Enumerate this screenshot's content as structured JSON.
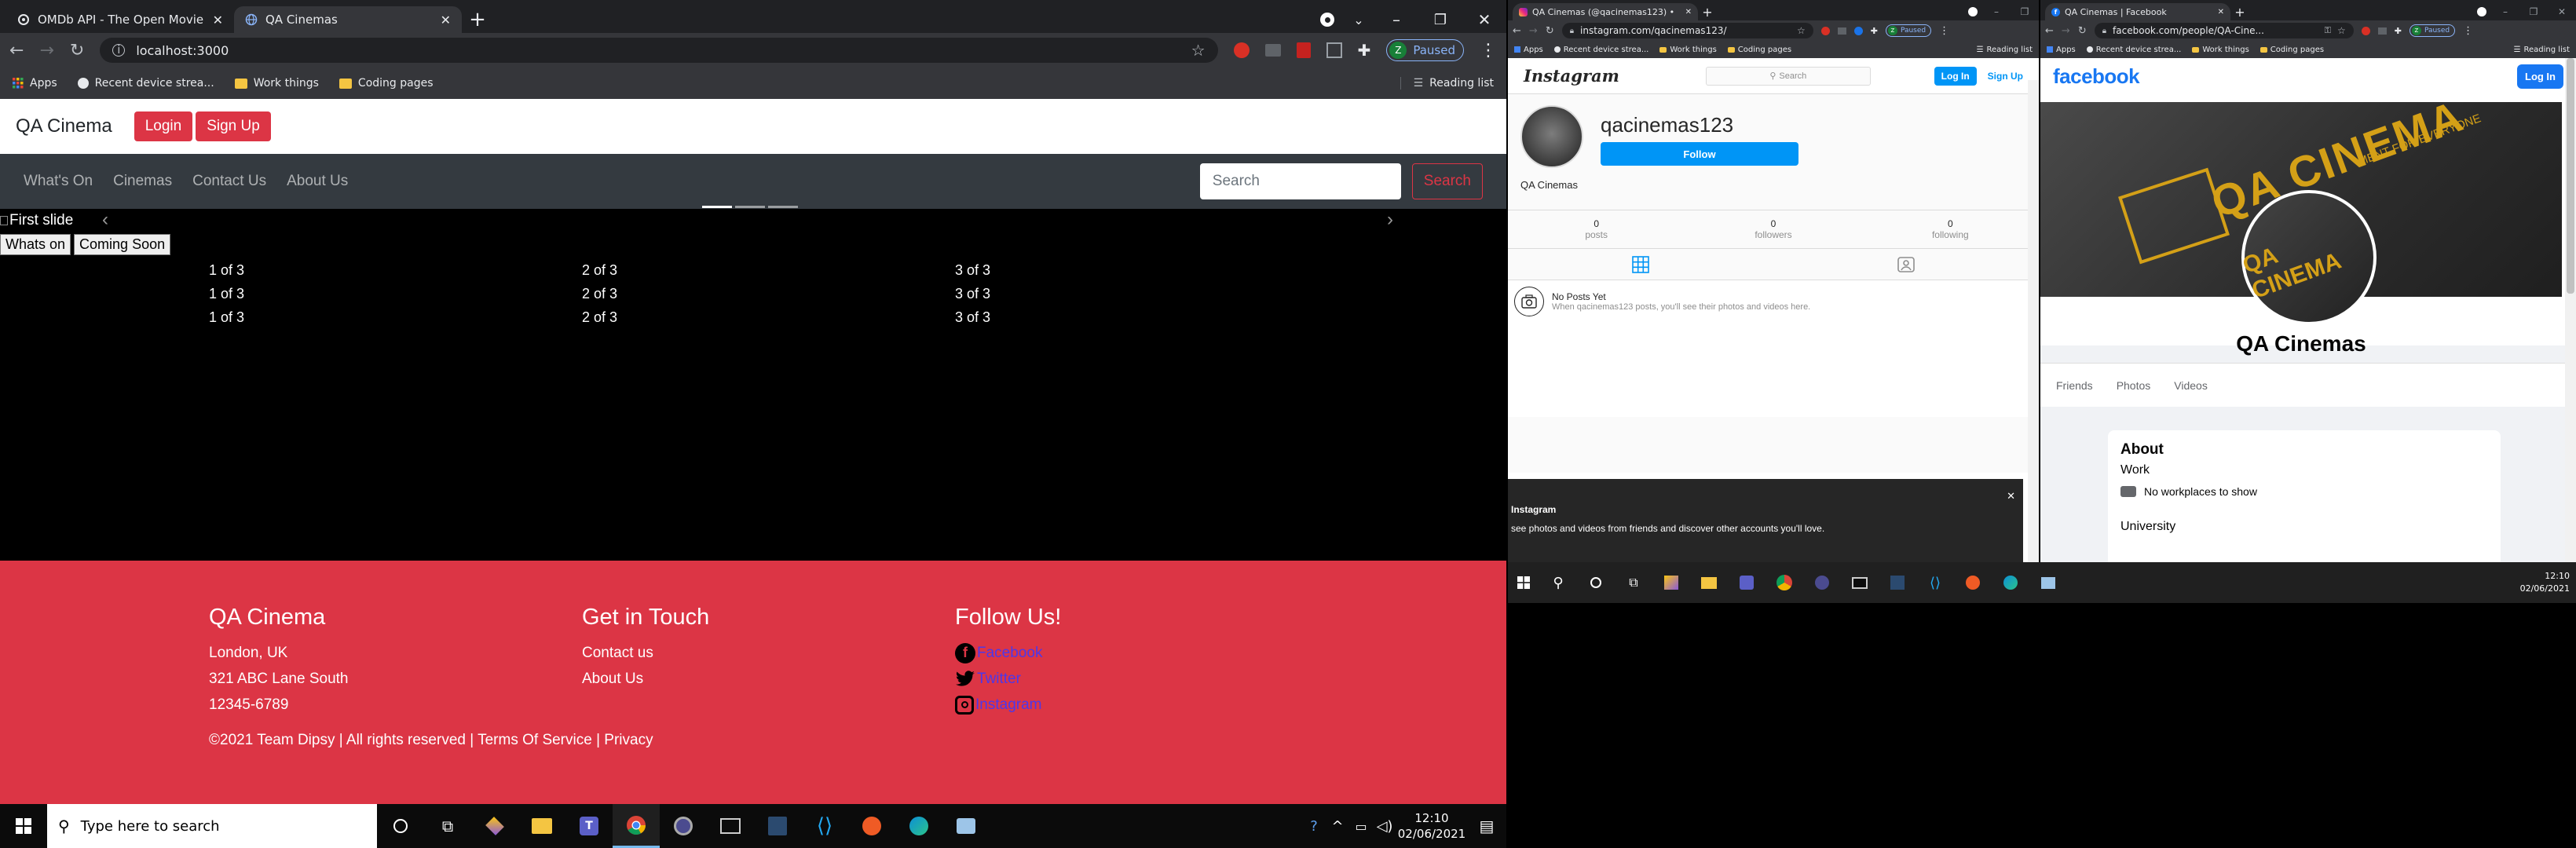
{
  "main_window": {
    "tabs": [
      {
        "title": "OMDb API - The Open Movie Da",
        "favicon": "omdb"
      },
      {
        "title": "QA Cinemas",
        "favicon": "globe"
      }
    ],
    "url": "localhost:3000",
    "paused_label": "Paused",
    "profile_letter": "Z",
    "bookmarks": [
      "Apps",
      "Recent device strea...",
      "Work things",
      "Coding pages"
    ],
    "reading_list": "Reading list"
  },
  "site": {
    "brand": "QA Cinema",
    "login": "Login",
    "signup": "Sign Up",
    "nav": [
      "What's On",
      "Cinemas",
      "Contact Us",
      "About Us"
    ],
    "search_placeholder": "Search",
    "search_button": "Search",
    "carousel_alt": "First slide",
    "slide_buttons": [
      "Whats on",
      "Coming Soon"
    ],
    "grid_rows": [
      [
        "1 of 3",
        "2 of 3",
        "3 of 3"
      ],
      [
        "1 of 3",
        "2 of 3",
        "3 of 3"
      ],
      [
        "1 of 3",
        "2 of 3",
        "3 of 3"
      ]
    ],
    "footer": {
      "col1_title": "QA Cinema",
      "col1_lines": [
        "London, UK",
        "321 ABC Lane South",
        "12345-6789"
      ],
      "col2_title": "Get in Touch",
      "col2_links": [
        "Contact us",
        "About Us"
      ],
      "col3_title": "Follow Us!",
      "col3_links": [
        "Facebook",
        "Twitter",
        "Instagram"
      ],
      "copyright": "©2021 Team Dipsy | All rights reserved | Terms Of Service | Privacy"
    }
  },
  "taskbar_main": {
    "search_placeholder": "Type here to search",
    "time": "12:10",
    "date": "02/06/2021"
  },
  "instagram_window": {
    "tab_title": "QA Cinemas (@qacinemas123) •",
    "url": "instagram.com/qacinemas123/",
    "paused_label": "Paused",
    "bookmarks": [
      "Apps",
      "Recent device strea...",
      "Work things",
      "Coding pages"
    ],
    "reading_list": "Reading list",
    "logo": "Instagram",
    "search_placeholder": "Search",
    "login": "Log In",
    "signup": "Sign Up",
    "username": "qacinemas123",
    "follow": "Follow",
    "fullname": "QA Cinemas",
    "stats": [
      {
        "value": "0",
        "label": "posts"
      },
      {
        "value": "0",
        "label": "followers"
      },
      {
        "value": "0",
        "label": "following"
      }
    ],
    "no_posts_title": "No Posts Yet",
    "no_posts_text": "When qacinemas123 posts, you'll see their photos and videos here.",
    "banner_title": "Instagram",
    "banner_text": "see photos and videos from friends and discover other accounts you'll love."
  },
  "facebook_window": {
    "tab_title": "QA Cinemas | Facebook",
    "url": "facebook.com/people/QA-Cine...",
    "paused_label": "Paused",
    "bookmarks": [
      "Apps",
      "Recent device strea...",
      "Work things",
      "Coding pages"
    ],
    "reading_list": "Reading list",
    "logo": "facebook",
    "login": "Log In",
    "cover_text": "QA CINEMA",
    "cover_tagline": "MENT FOR EVERYONE",
    "page_name": "QA Cinemas",
    "tabs": [
      "Friends",
      "Photos",
      "Videos"
    ],
    "about_title": "About",
    "work_label": "Work",
    "no_workplaces": "No workplaces to show",
    "university_label": "University"
  },
  "taskbar_right": {
    "time": "12:10",
    "date": "02/06/2021"
  }
}
